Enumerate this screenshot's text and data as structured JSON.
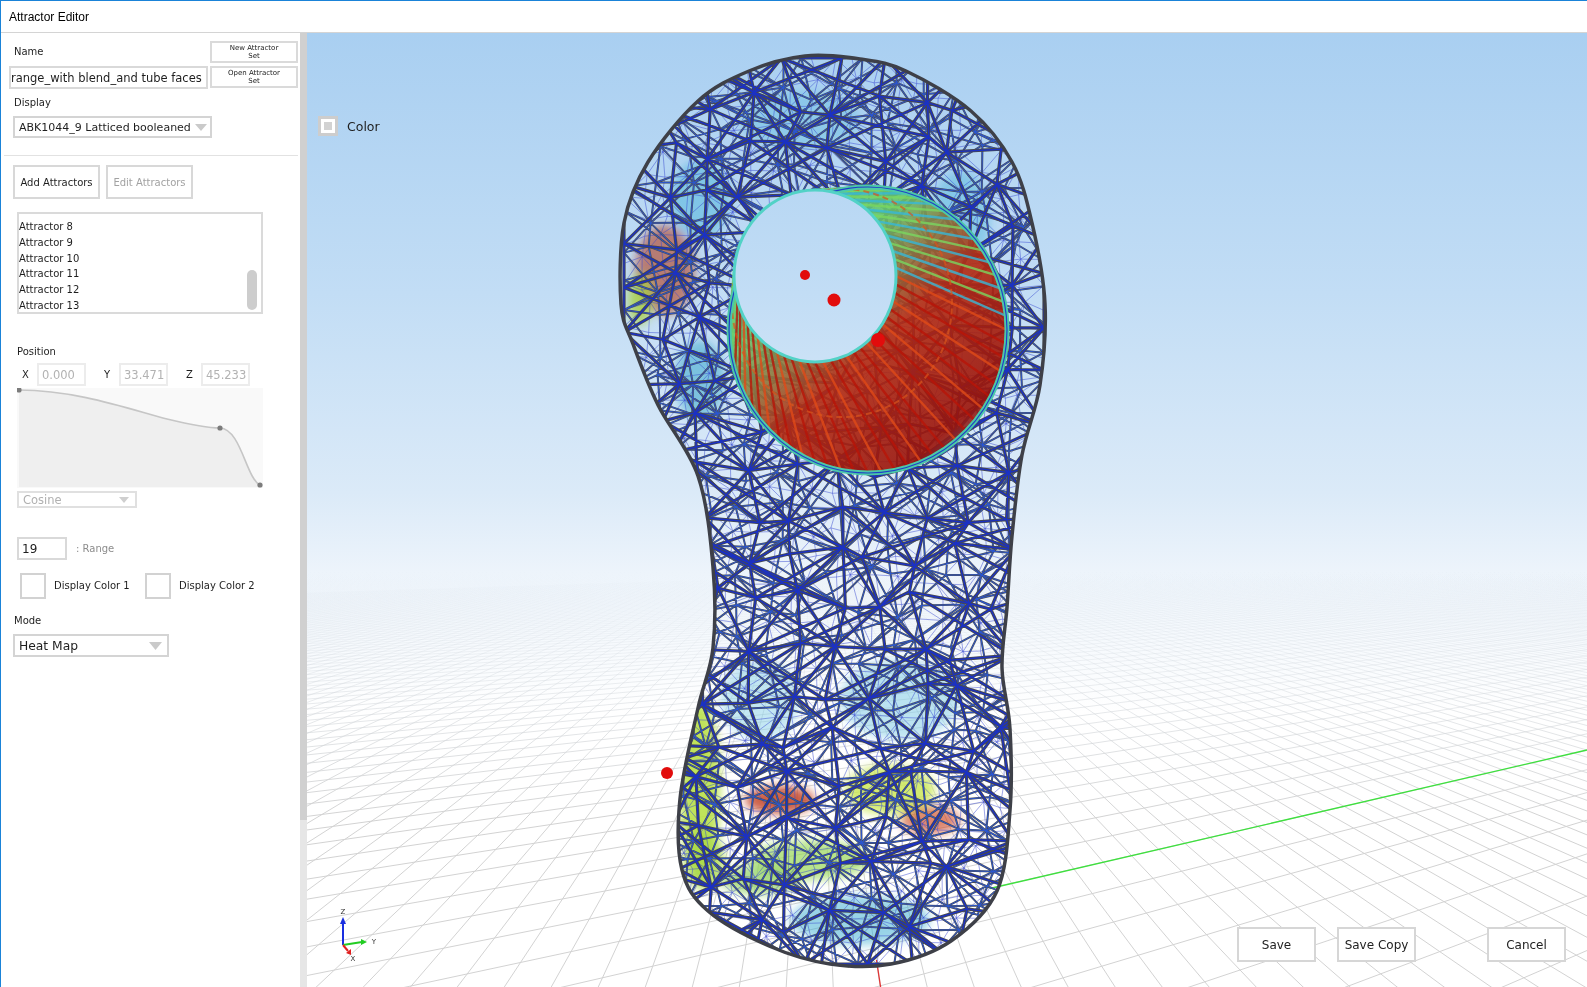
{
  "window": {
    "title": "Attractor Editor"
  },
  "attractor_set": {
    "name_label": "Name",
    "name": "range_with blend_and tube faces",
    "buttons": [
      {
        "label": "New Attractor Set"
      },
      {
        "label": "Open Attractor Set"
      }
    ]
  },
  "display": {
    "label": "Display",
    "value": "ABK1044_9 Latticed booleaned"
  },
  "attractor_buttons": [
    {
      "label": "Add Attractors",
      "disabled": false
    },
    {
      "label": "Edit Attractors",
      "disabled": true
    }
  ],
  "attractor_list": [
    {
      "label": "Attractor 8",
      "selected": false
    },
    {
      "label": "Attractor 9",
      "selected": false
    },
    {
      "label": "Attractor 10",
      "selected": false
    },
    {
      "label": "Attractor 11",
      "selected": false
    },
    {
      "label": "Attractor 12",
      "selected": false
    },
    {
      "label": "Attractor 13",
      "selected": false
    }
  ],
  "position": {
    "label": "Position",
    "fields": [
      {
        "axis": "X",
        "value": "0.000",
        "disabled": true
      },
      {
        "axis": "Y",
        "value": "33.471",
        "disabled": true
      },
      {
        "axis": "Z",
        "value": "45.233",
        "disabled": true
      }
    ],
    "falloff": {
      "value": "Cosine",
      "disabled": true
    }
  },
  "range": {
    "value": "19",
    "label": ": Range"
  },
  "display_colors": [
    {
      "label": "Display Color 1"
    },
    {
      "label": "Display Color 2"
    }
  ],
  "mode": {
    "label": "Mode",
    "value": "Heat Map"
  },
  "viewport": {
    "color_toggle": {
      "label": "Color",
      "checked": false
    },
    "axis_gizmo": [
      {
        "kind": "z",
        "label": "Z"
      },
      {
        "kind": "y",
        "label": "Y"
      },
      {
        "kind": "x",
        "label": "X"
      }
    ]
  },
  "actions": [
    {
      "label": "Save"
    },
    {
      "label": "Save Copy"
    },
    {
      "label": "Cancel"
    }
  ]
}
